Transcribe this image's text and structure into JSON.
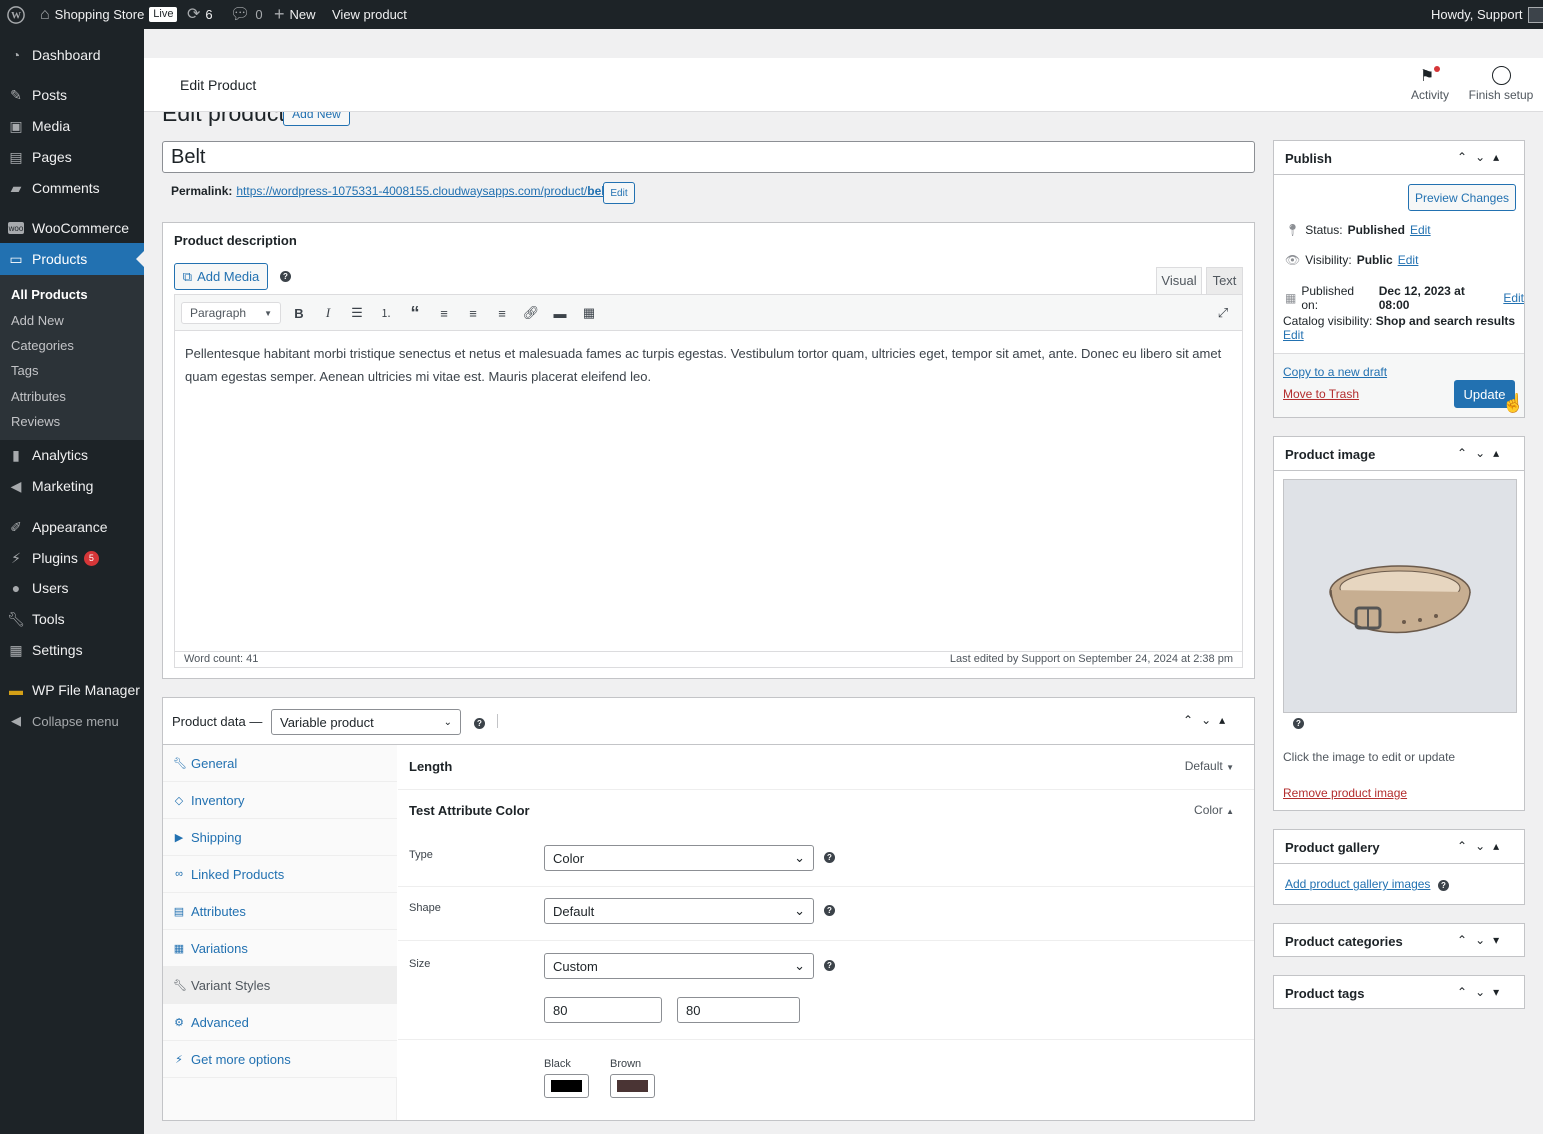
{
  "adminbar": {
    "site_name": "Shopping Store",
    "live_label": "Live",
    "updates_count": "6",
    "comments_count": "0",
    "new_label": "New",
    "view_label": "View product",
    "howdy": "Howdy, Support"
  },
  "sidebar": {
    "items": [
      {
        "label": "Dashboard",
        "icon": "dashboard-icon"
      },
      {
        "label": "Posts",
        "icon": "pin-icon"
      },
      {
        "label": "Media",
        "icon": "media-icon"
      },
      {
        "label": "Pages",
        "icon": "pages-icon"
      },
      {
        "label": "Comments",
        "icon": "comment-icon"
      },
      {
        "label": "WooCommerce",
        "icon": "woo-icon"
      },
      {
        "label": "Products",
        "icon": "archive-icon"
      },
      {
        "label": "Analytics",
        "icon": "bar-chart-icon"
      },
      {
        "label": "Marketing",
        "icon": "megaphone-icon"
      },
      {
        "label": "Appearance",
        "icon": "brush-icon"
      },
      {
        "label": "Plugins",
        "icon": "plug-icon",
        "badge": "5"
      },
      {
        "label": "Users",
        "icon": "user-icon"
      },
      {
        "label": "Tools",
        "icon": "wrench-icon"
      },
      {
        "label": "Settings",
        "icon": "settings-icon"
      },
      {
        "label": "WP File Manager",
        "icon": "folder-icon"
      },
      {
        "label": "Collapse menu",
        "icon": "collapse-icon"
      }
    ],
    "submenu": [
      "All Products",
      "Add New",
      "Categories",
      "Tags",
      "Attributes",
      "Reviews"
    ]
  },
  "header": {
    "title": "Edit Product",
    "activity": "Activity",
    "finish_setup": "Finish setup"
  },
  "page": {
    "heading": "Edit product",
    "add_new": "Add New",
    "title_value": "Belt",
    "permalink_label": "Permalink:",
    "permalink_url_base": "https://wordpress-1075331-4008155.cloudwaysapps.com/product/",
    "permalink_slug": "belt",
    "permalink_edit": "Edit"
  },
  "description": {
    "title": "Product description",
    "add_media": "Add Media",
    "tab_visual": "Visual",
    "tab_text": "Text",
    "format": "Paragraph",
    "content": "Pellentesque habitant morbi tristique senectus et netus et malesuada fames ac turpis egestas. Vestibulum tortor quam, ultricies eget, tempor sit amet, ante. Donec eu libero sit amet quam egestas semper. Aenean ultricies mi vitae est. Mauris placerat eleifend leo.",
    "word_count": "Word count: 41",
    "last_edited": "Last edited by Support on September 24, 2024 at 2:38 pm"
  },
  "product_data": {
    "label": "Product data —",
    "type": "Variable product",
    "tabs": [
      "General",
      "Inventory",
      "Shipping",
      "Linked Products",
      "Attributes",
      "Variations",
      "Variant Styles",
      "Advanced",
      "Get more options"
    ],
    "length_label": "Length",
    "length_value": "Default",
    "attr_label": "Test Attribute Color",
    "attr_value": "Color",
    "type_label": "Type",
    "type_value": "Color",
    "shape_label": "Shape",
    "shape_value": "Default",
    "size_label": "Size",
    "size_value": "Custom",
    "width": "80",
    "height": "80",
    "swatches": [
      {
        "name": "Black",
        "color": "#000000"
      },
      {
        "name": "Brown",
        "color": "#4a3434"
      }
    ]
  },
  "publish": {
    "title": "Publish",
    "preview": "Preview Changes",
    "status_label": "Status:",
    "status_value": "Published",
    "visibility_label": "Visibility:",
    "visibility_value": "Public",
    "published_label": "Published on:",
    "published_value": "Dec 12, 2023 at 08:00",
    "catalog_label": "Catalog visibility:",
    "catalog_value": "Shop and search results",
    "edit": "Edit",
    "copy_draft": "Copy to a new draft",
    "trash": "Move to Trash",
    "update": "Update"
  },
  "product_image": {
    "title": "Product image",
    "hint": "Click the image to edit or update",
    "remove": "Remove product image"
  },
  "gallery": {
    "title": "Product gallery",
    "add": "Add product gallery images"
  },
  "categories": {
    "title": "Product categories"
  },
  "tags": {
    "title": "Product tags"
  },
  "colors": {
    "accent": "#2271b1",
    "admin_bar": "#1d2327",
    "danger": "#b32d2e"
  }
}
